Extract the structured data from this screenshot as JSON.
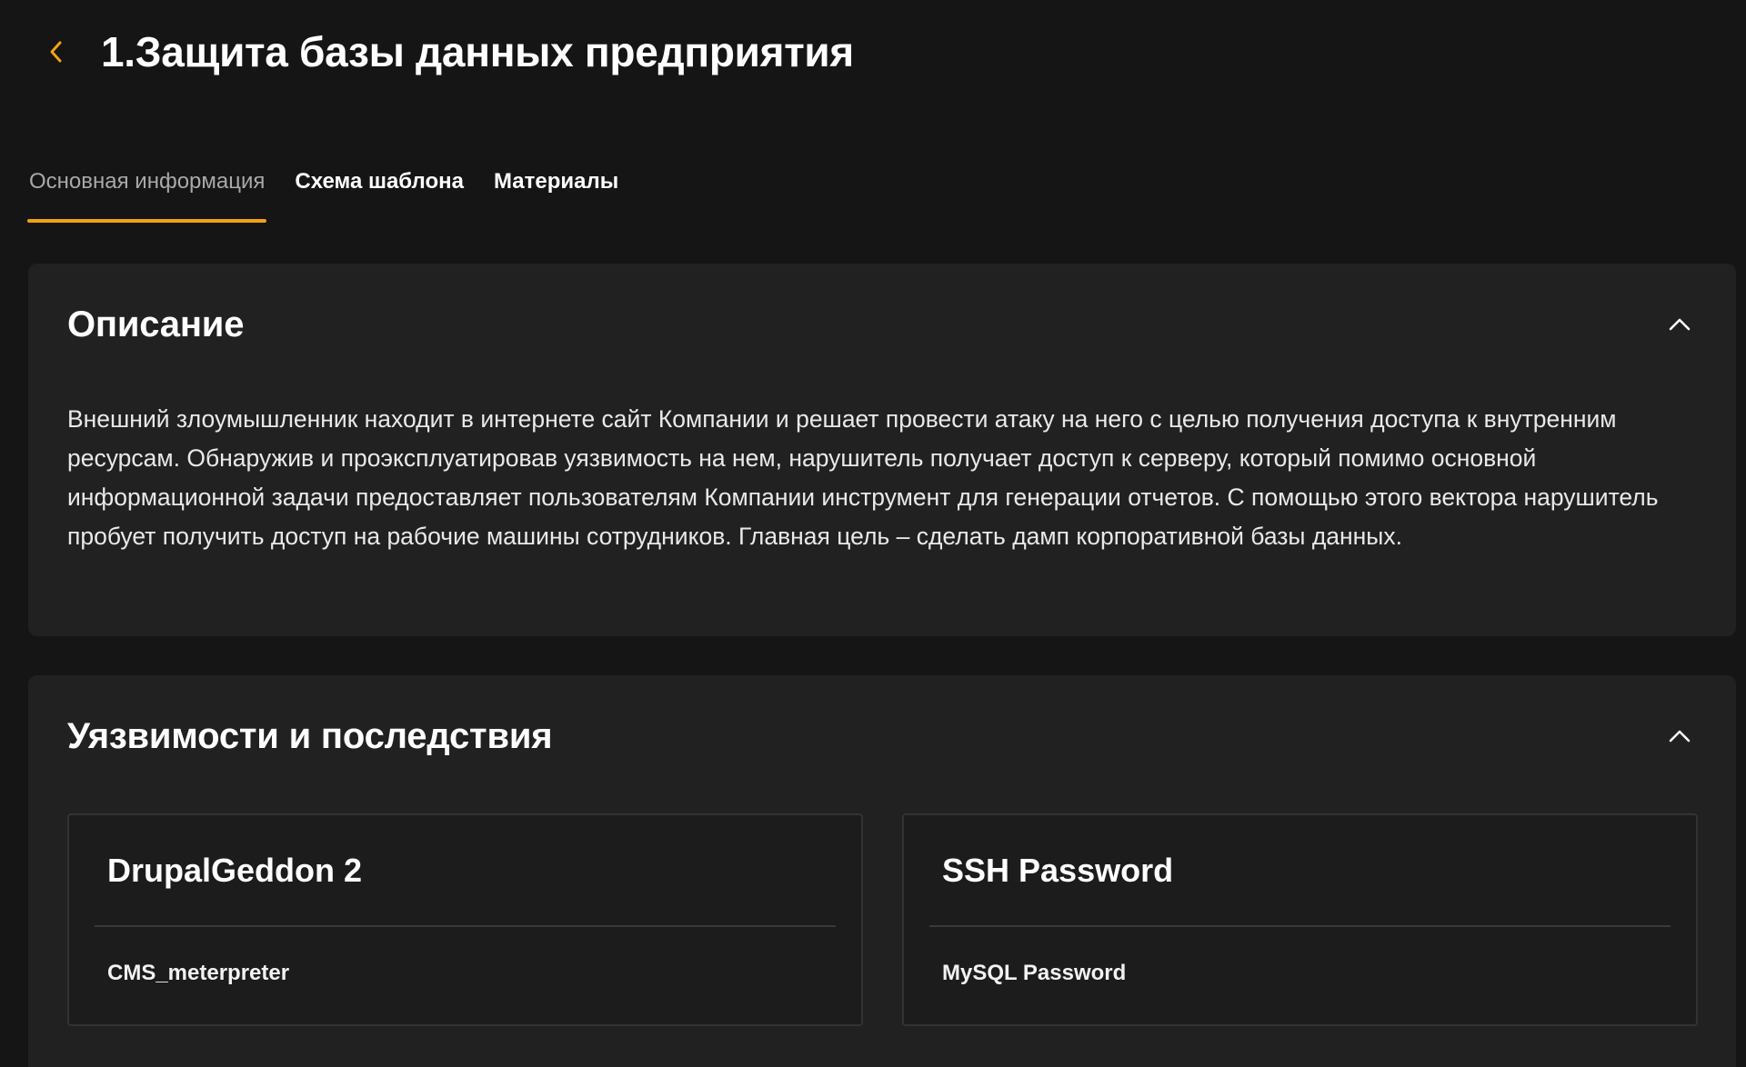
{
  "header": {
    "title": "1.Защита базы данных предприятия",
    "back_icon": "chevron-left-icon",
    "accent_color": "#f3a20f"
  },
  "tabs": [
    {
      "label": "Основная информация",
      "active": true
    },
    {
      "label": "Схема шаблона",
      "active": false
    },
    {
      "label": "Материалы",
      "active": false
    }
  ],
  "description": {
    "title": "Описание",
    "collapse_icon": "chevron-up-icon",
    "text": "Внешний злоумышленник находит в интернете сайт Компании и решает провести атаку на него с целью получения доступа к внутренним ресурсам. Обнаружив и проэксплуатировав уязвимость на нем, нарушитель получает доступ к серверу, который помимо основной информационной задачи предоставляет пользователям Компании инструмент для генерации отчетов. С помощью этого вектора нарушитель пробует получить доступ на рабочие машины сотрудников. Главная цель – сделать дамп корпоративной базы данных."
  },
  "vulnerabilities": {
    "title": "Уязвимости и последствия",
    "collapse_icon": "chevron-up-icon",
    "items": [
      {
        "name": "DrupalGeddon 2",
        "consequence": "CMS_meterpreter"
      },
      {
        "name": "SSH Password",
        "consequence": "MySQL Password"
      }
    ]
  }
}
